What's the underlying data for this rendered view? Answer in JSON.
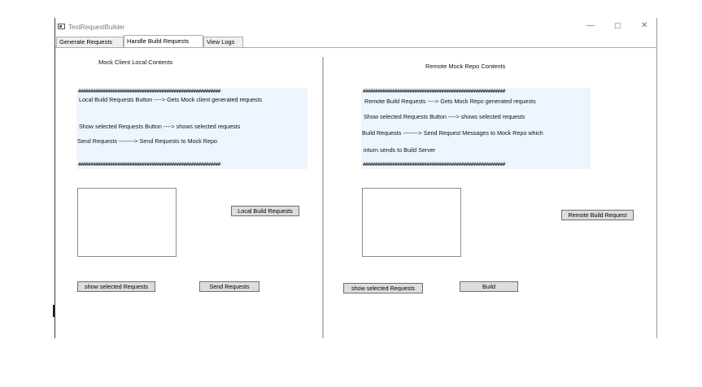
{
  "window": {
    "title": "TestRequestBuilder",
    "controls": {
      "minimize": "—",
      "maximize": "☐",
      "close": "✕"
    }
  },
  "tabs": [
    {
      "label": "Generate Requests",
      "active": false
    },
    {
      "label": "Handle Build Requests",
      "active": true
    },
    {
      "label": "View Logs",
      "active": false
    }
  ],
  "left_panel": {
    "heading": "Mock Client Local Contents",
    "info": {
      "separator": "##########################################################",
      "lines": [
        "Local Build Requests Button ----> Gets Mock client generated requests",
        "Show selected Requests Button ----> shows selected requests",
        "Send Requests --------> Send Requests to Mock Repo"
      ]
    },
    "buttons": {
      "local_build": "Local Build Requests",
      "show_selected": "show selected Requests",
      "send": "Send Requests"
    }
  },
  "right_panel": {
    "heading": "Remote Mock Repo Contents",
    "info": {
      "separator": "##########################################################",
      "lines": [
        "Remote Build Requests ----> Gets Mock Repo generated requests",
        "Show selected Requests Button ----> shows selected requests",
        "Build Requests --------> Send Request Messages to Mock Repo which",
        "inturn sends to Build Server"
      ]
    },
    "buttons": {
      "remote_build": "Remote Build Request",
      "show_selected": "show selected Requests",
      "build": "Build"
    }
  }
}
